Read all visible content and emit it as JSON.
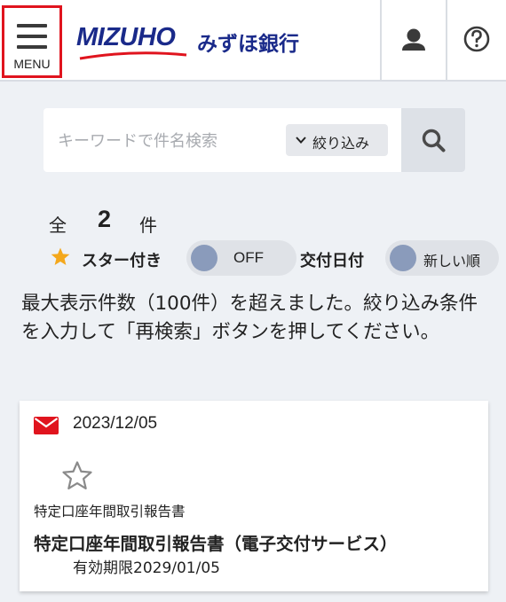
{
  "header": {
    "menu_label": "MENU",
    "brand_latin": "MIZUHO",
    "bank_name": "みずほ銀行",
    "brand_color": "#1a2a8a",
    "accent_red": "#e0141e",
    "user_icon": "user-icon",
    "help_icon": "help-icon"
  },
  "search": {
    "placeholder": "キーワードで件名検索",
    "filter_label": "絞り込み",
    "search_icon": "search-icon"
  },
  "results": {
    "count_prefix": "全",
    "count": "2",
    "count_suffix": "件"
  },
  "filters": {
    "star_label": "スター付き",
    "star_toggle_state": "OFF",
    "sort_label": "交付日付",
    "sort_order": "新しい順"
  },
  "message": "最大表示件数（100件）を超えました。絞り込み条件を入力して「再検索」ボタンを押してください。",
  "documents": [
    {
      "date": "2023/12/05",
      "category": "特定口座年間取引報告書",
      "title": "特定口座年間取引報告書（電子交付サービス）",
      "expiry": "有効期限2029/01/05",
      "starred": false,
      "unread": true
    }
  ]
}
